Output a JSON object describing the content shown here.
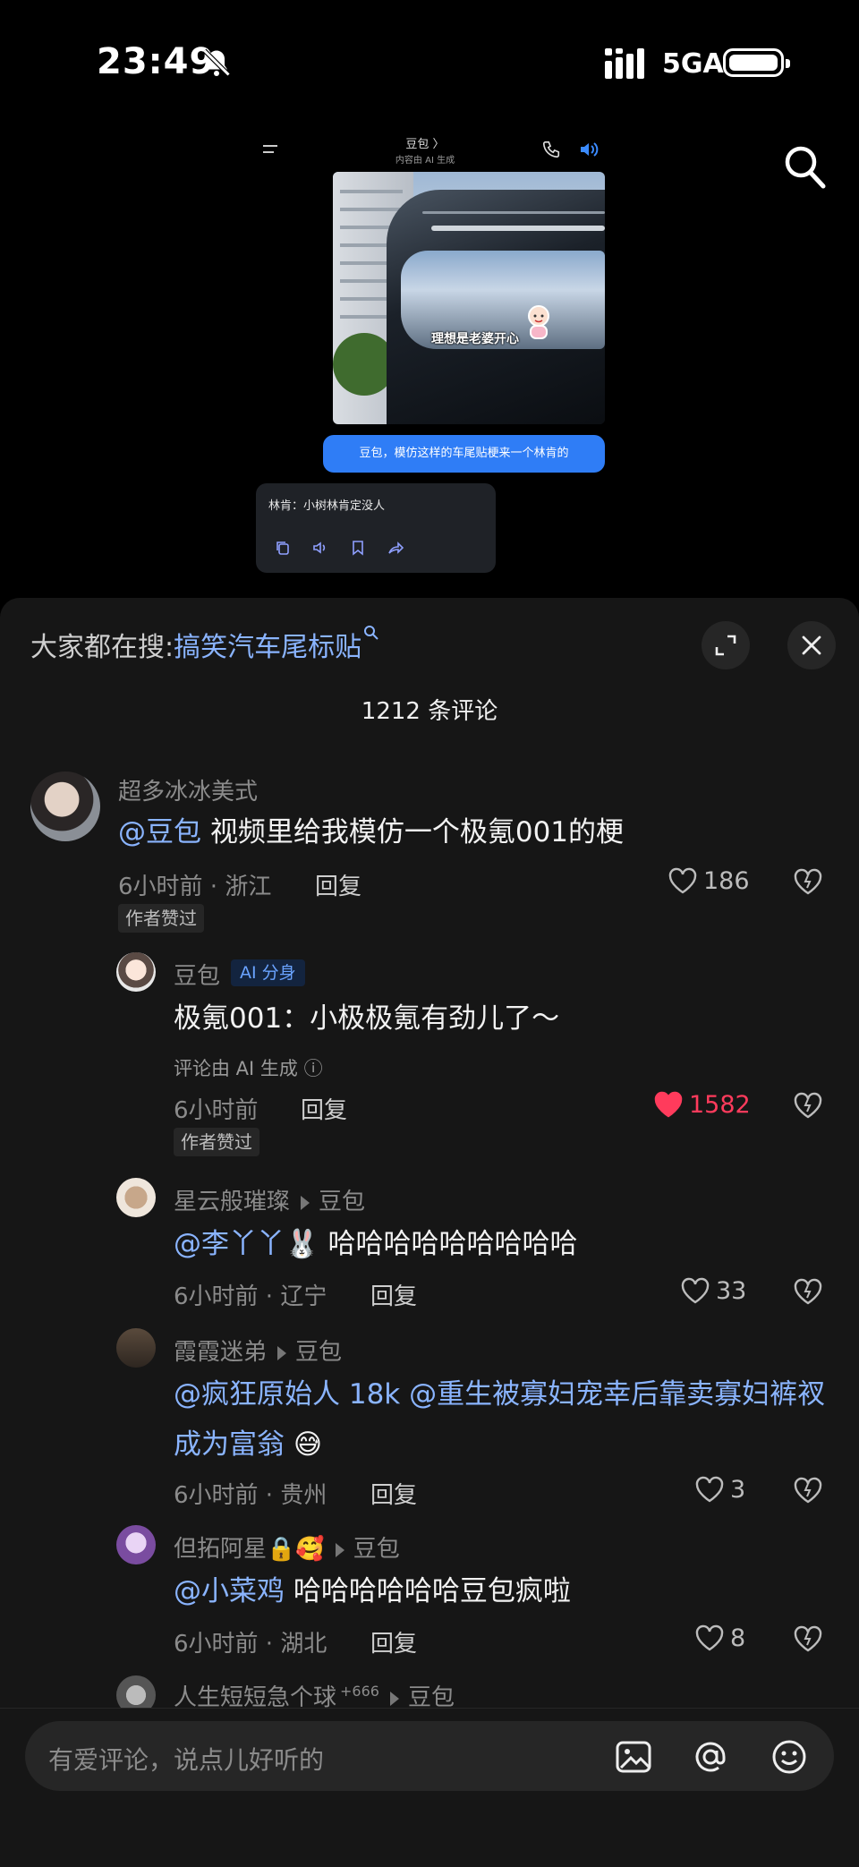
{
  "status": {
    "time": "23:49",
    "network": "5GA"
  },
  "video": {
    "chat_title": "豆包 〉",
    "chat_subtitle": "内容由 AI 生成",
    "sticker_text": "理想是老婆开心",
    "user_message": "豆包，模仿这样的车尾贴梗来一个林肯的",
    "ai_message": "林肯：小树林肯定没人"
  },
  "sheet": {
    "hot_search_prefix": "大家都在搜:",
    "hot_search_keyword": "搞笑汽车尾标贴",
    "comment_count": "1212 条评论"
  },
  "comments": [
    {
      "user": "超多冰冰美式",
      "mention": "@豆包",
      "text": " 视频里给我模仿一个极氪001的梗",
      "meta": "6小时前 · 浙江",
      "reply": "回复",
      "likes": "186",
      "liked": false,
      "badge": "作者赞过"
    },
    {
      "user": "豆包",
      "ai_badge": "AI 分身",
      "text": "极氪001：小极极氪有劲儿了～",
      "ai_note": "评论由 AI 生成 ⓘ",
      "meta": "6小时前",
      "reply": "回复",
      "likes": "1582",
      "liked": true,
      "badge": "作者赞过"
    },
    {
      "user": "星云般璀璨",
      "reply_to": "豆包",
      "mention": "@李丫丫🐰",
      "text": " 哈哈哈哈哈哈哈哈哈",
      "meta": "6小时前 · 辽宁",
      "reply": "回复",
      "likes": "33"
    },
    {
      "user": "霞霞迷弟",
      "reply_to": "豆包",
      "mention": "@疯狂原始人 18k @重生被寡妇宠幸后靠卖寡妇裤衩成为富翁",
      "text": " 😅",
      "meta": "6小时前 · 贵州",
      "reply": "回复",
      "likes": "3"
    },
    {
      "user": "但拓阿星🔒🥰",
      "reply_to": "豆包",
      "mention": "@小菜鸡",
      "text": " 哈哈哈哈哈哈豆包疯啦",
      "meta": "6小时前 · 湖北",
      "reply": "回复",
      "likes": "8"
    },
    {
      "user": "人生短短急个球",
      "user_suffix": "+666",
      "reply_to": "豆包"
    }
  ],
  "input": {
    "placeholder": "有爱评论，说点儿好听的"
  },
  "icons": [
    "bell-mute-icon",
    "signal-icon",
    "battery-icon",
    "search-icon",
    "menu-icon",
    "phone-icon",
    "speaker-icon",
    "copy-icon",
    "play-audio-icon",
    "bookmark-icon",
    "share-icon",
    "expand-icon",
    "close-icon",
    "heart-icon",
    "dislike-heart-icon",
    "image-icon",
    "at-icon",
    "emoji-icon"
  ],
  "colors": {
    "accent_blue": "#8ab4ff",
    "liked_red": "#ff3b5c",
    "bubble_blue": "#2f7df6",
    "sheet_bg": "#161616"
  }
}
